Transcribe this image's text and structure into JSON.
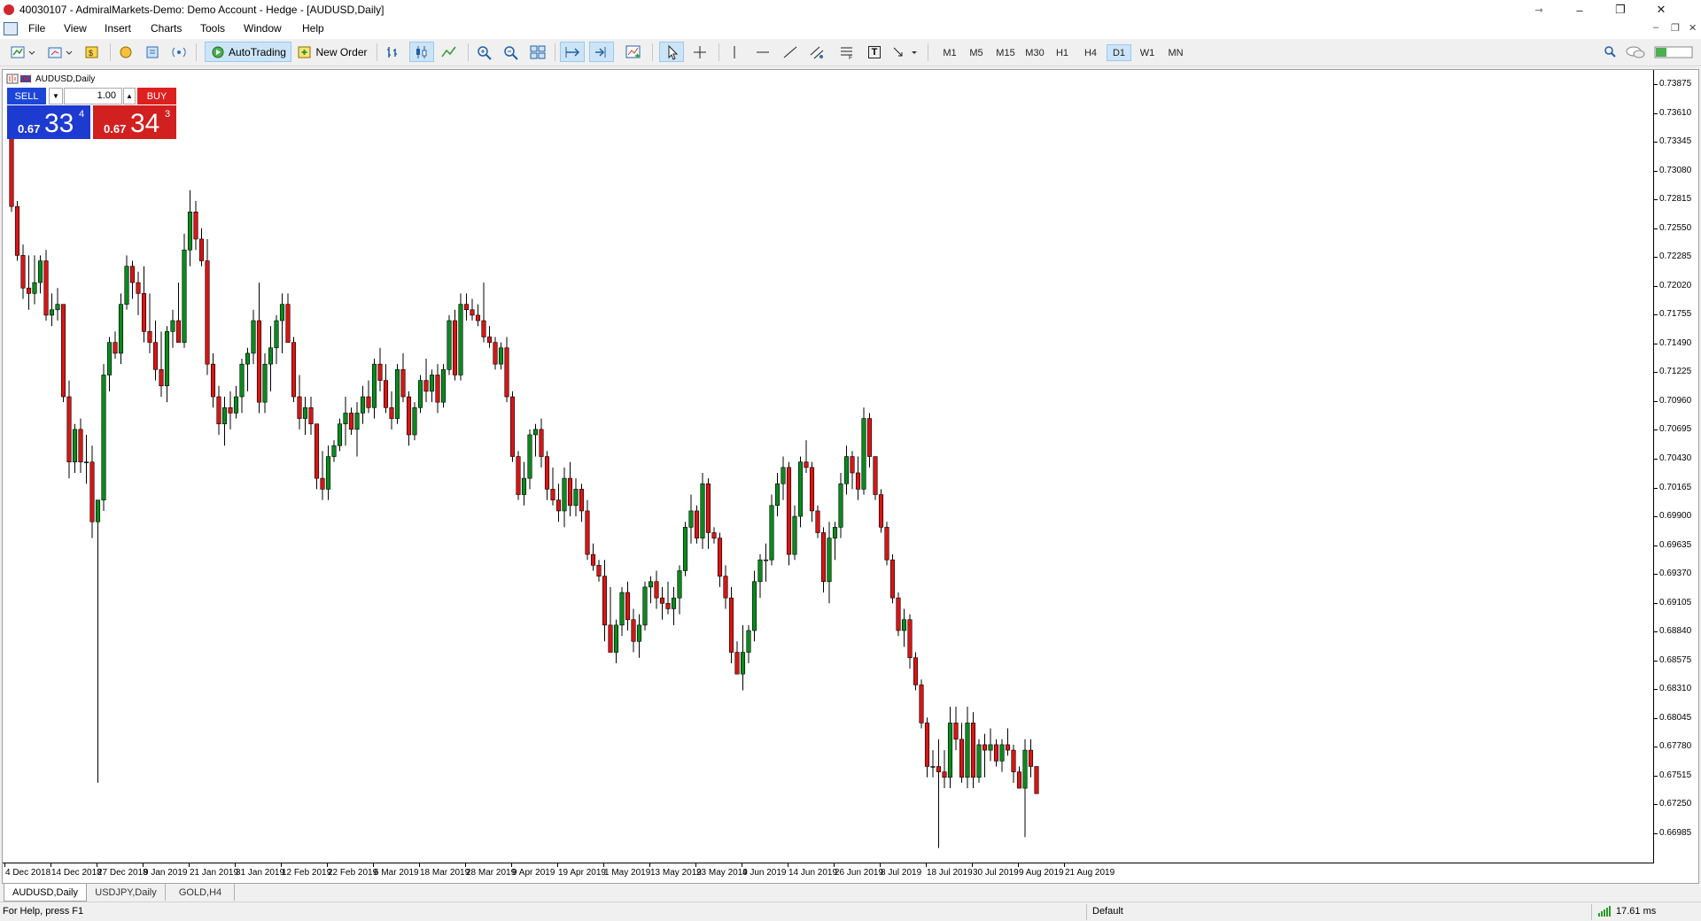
{
  "window": {
    "title": "40030107 - AdmiralMarkets-Demo: Demo Account - Hedge - [AUDUSD,Daily]",
    "controls": {
      "minimize": "–",
      "maximize": "❐",
      "close": "✕",
      "ribbon": "⇾"
    }
  },
  "menu": {
    "items": [
      "File",
      "View",
      "Insert",
      "Charts",
      "Tools",
      "Window",
      "Help"
    ],
    "mdi": {
      "minimize": "–",
      "restore": "❐",
      "close": "✕"
    }
  },
  "toolbar": {
    "autotrading_label": "AutoTrading",
    "new_order_label": "New Order",
    "timeframes": [
      "M1",
      "M5",
      "M15",
      "M30",
      "H1",
      "H4",
      "D1",
      "W1",
      "MN"
    ],
    "active_timeframe": "D1",
    "text_tool": "T",
    "label_tool": "A"
  },
  "chart": {
    "title": "AUDUSD,Daily",
    "one_click": {
      "sell_label": "SELL",
      "buy_label": "BUY",
      "lot": "1.00",
      "sell_small": "0.67",
      "sell_big": "33",
      "sell_sup": "4",
      "buy_small": "0.67",
      "buy_big": "34",
      "buy_sup": "3"
    },
    "price_labels": [
      "0.73875",
      "0.73610",
      "0.73345",
      "0.73080",
      "0.72815",
      "0.72550",
      "0.72285",
      "0.72020",
      "0.71755",
      "0.71490",
      "0.71225",
      "0.70960",
      "0.70695",
      "0.70430",
      "0.70165",
      "0.69900",
      "0.69635",
      "0.69370",
      "0.69105",
      "0.68840",
      "0.68575",
      "0.68310",
      "0.68045",
      "0.67780",
      "0.67515",
      "0.67250",
      "0.66985"
    ],
    "date_labels": [
      "4 Dec 2018",
      "14 Dec 2018",
      "27 Dec 2018",
      "9 Jan 2019",
      "21 Jan 2019",
      "31 Jan 2019",
      "12 Feb 2019",
      "22 Feb 2019",
      "6 Mar 2019",
      "18 Mar 2019",
      "28 Mar 2019",
      "9 Apr 2019",
      "19 Apr 2019",
      "1 May 2019",
      "13 May 2019",
      "23 May 2019",
      "4 Jun 2019",
      "14 Jun 2019",
      "26 Jun 2019",
      "8 Jul 2019",
      "18 Jul 2019",
      "30 Jul 2019",
      "9 Aug 2019",
      "21 Aug 2019"
    ],
    "colors": {
      "bull": "#0a8a1e",
      "bear": "#d81515",
      "wick": "#000000"
    }
  },
  "tabs": [
    "AUDUSD,Daily",
    "USDJPY,Daily",
    "GOLD,H4"
  ],
  "active_tab": "AUDUSD,Daily",
  "status": {
    "help": "For Help, press F1",
    "profile": "Default",
    "ping": "17.61 ms"
  },
  "chart_data": {
    "type": "candlestick",
    "symbol": "AUDUSD",
    "timeframe": "Daily",
    "ylim": [
      0.6685,
      0.74
    ],
    "grid": false,
    "candles": [
      [
        0.7365,
        0.7365,
        0.727,
        0.7275
      ],
      [
        0.7275,
        0.728,
        0.7225,
        0.723
      ],
      [
        0.723,
        0.724,
        0.719,
        0.72
      ],
      [
        0.72,
        0.723,
        0.718,
        0.7195
      ],
      [
        0.7195,
        0.723,
        0.7185,
        0.7205
      ],
      [
        0.7205,
        0.723,
        0.7195,
        0.7225
      ],
      [
        0.7225,
        0.7235,
        0.717,
        0.7175
      ],
      [
        0.7175,
        0.7195,
        0.7165,
        0.718
      ],
      [
        0.718,
        0.72,
        0.717,
        0.7185
      ],
      [
        0.7185,
        0.7185,
        0.7095,
        0.71
      ],
      [
        0.71,
        0.7115,
        0.7025,
        0.704
      ],
      [
        0.704,
        0.7075,
        0.703,
        0.707
      ],
      [
        0.707,
        0.708,
        0.703,
        0.704
      ],
      [
        0.704,
        0.7065,
        0.702,
        0.704
      ],
      [
        0.704,
        0.7055,
        0.697,
        0.6985
      ],
      [
        0.6985,
        0.7,
        0.6745,
        0.7005
      ],
      [
        0.7005,
        0.713,
        0.6995,
        0.712
      ],
      [
        0.712,
        0.7155,
        0.7105,
        0.715
      ],
      [
        0.715,
        0.716,
        0.7135,
        0.714
      ],
      [
        0.714,
        0.7195,
        0.713,
        0.7185
      ],
      [
        0.7185,
        0.723,
        0.718,
        0.722
      ],
      [
        0.722,
        0.7225,
        0.719,
        0.7205
      ],
      [
        0.7205,
        0.7215,
        0.7175,
        0.7195
      ],
      [
        0.7195,
        0.722,
        0.715,
        0.716
      ],
      [
        0.716,
        0.7195,
        0.714,
        0.715
      ],
      [
        0.715,
        0.717,
        0.7115,
        0.7125
      ],
      [
        0.7125,
        0.716,
        0.71,
        0.711
      ],
      [
        0.711,
        0.7165,
        0.7095,
        0.716
      ],
      [
        0.716,
        0.718,
        0.7145,
        0.717
      ],
      [
        0.717,
        0.7205,
        0.715,
        0.715
      ],
      [
        0.715,
        0.725,
        0.7145,
        0.7235
      ],
      [
        0.7235,
        0.729,
        0.722,
        0.727
      ],
      [
        0.727,
        0.728,
        0.7235,
        0.7245
      ],
      [
        0.7245,
        0.7255,
        0.722,
        0.7225
      ],
      [
        0.7225,
        0.7245,
        0.712,
        0.713
      ],
      [
        0.713,
        0.714,
        0.709,
        0.71
      ],
      [
        0.71,
        0.711,
        0.7065,
        0.7075
      ],
      [
        0.7075,
        0.71,
        0.7055,
        0.709
      ],
      [
        0.709,
        0.7105,
        0.707,
        0.7085
      ],
      [
        0.7085,
        0.711,
        0.708,
        0.71
      ],
      [
        0.71,
        0.7135,
        0.7085,
        0.713
      ],
      [
        0.713,
        0.7145,
        0.7105,
        0.714
      ],
      [
        0.714,
        0.718,
        0.713,
        0.717
      ],
      [
        0.717,
        0.7205,
        0.7085,
        0.7095
      ],
      [
        0.7095,
        0.714,
        0.7085,
        0.713
      ],
      [
        0.713,
        0.7165,
        0.7105,
        0.7145
      ],
      [
        0.7145,
        0.7175,
        0.713,
        0.717
      ],
      [
        0.717,
        0.7195,
        0.714,
        0.7185
      ],
      [
        0.7185,
        0.7195,
        0.715,
        0.715
      ],
      [
        0.715,
        0.7155,
        0.7095,
        0.71
      ],
      [
        0.71,
        0.712,
        0.707,
        0.708
      ],
      [
        0.708,
        0.71,
        0.7065,
        0.709
      ],
      [
        0.709,
        0.71,
        0.7065,
        0.7075
      ],
      [
        0.7075,
        0.7075,
        0.7015,
        0.7025
      ],
      [
        0.7025,
        0.705,
        0.7005,
        0.7015
      ],
      [
        0.7015,
        0.7055,
        0.7005,
        0.7045
      ],
      [
        0.7045,
        0.706,
        0.704,
        0.7055
      ],
      [
        0.7055,
        0.708,
        0.705,
        0.7075
      ],
      [
        0.7075,
        0.71,
        0.7055,
        0.7085
      ],
      [
        0.7085,
        0.709,
        0.7065,
        0.707
      ],
      [
        0.707,
        0.7095,
        0.7045,
        0.7085
      ],
      [
        0.7085,
        0.711,
        0.7075,
        0.71
      ],
      [
        0.71,
        0.7115,
        0.7085,
        0.709
      ],
      [
        0.709,
        0.7135,
        0.708,
        0.713
      ],
      [
        0.713,
        0.7145,
        0.7105,
        0.7115
      ],
      [
        0.7115,
        0.713,
        0.7085,
        0.709
      ],
      [
        0.709,
        0.7105,
        0.707,
        0.708
      ],
      [
        0.708,
        0.713,
        0.7075,
        0.7125
      ],
      [
        0.7125,
        0.714,
        0.7095,
        0.71
      ],
      [
        0.71,
        0.7105,
        0.7055,
        0.7065
      ],
      [
        0.7065,
        0.7095,
        0.706,
        0.709
      ],
      [
        0.709,
        0.712,
        0.7085,
        0.7115
      ],
      [
        0.7115,
        0.7135,
        0.7095,
        0.7105
      ],
      [
        0.7105,
        0.7125,
        0.7095,
        0.712
      ],
      [
        0.712,
        0.713,
        0.7085,
        0.7095
      ],
      [
        0.7095,
        0.713,
        0.709,
        0.7125
      ],
      [
        0.7125,
        0.7175,
        0.712,
        0.717
      ],
      [
        0.717,
        0.718,
        0.7115,
        0.712
      ],
      [
        0.712,
        0.7195,
        0.7115,
        0.7185
      ],
      [
        0.7185,
        0.7195,
        0.717,
        0.718
      ],
      [
        0.718,
        0.719,
        0.717,
        0.7175
      ],
      [
        0.7175,
        0.7185,
        0.7165,
        0.717
      ],
      [
        0.717,
        0.7205,
        0.715,
        0.7155
      ],
      [
        0.7155,
        0.7165,
        0.7145,
        0.715
      ],
      [
        0.715,
        0.7155,
        0.7125,
        0.713
      ],
      [
        0.713,
        0.715,
        0.7125,
        0.7145
      ],
      [
        0.7145,
        0.7155,
        0.7095,
        0.71
      ],
      [
        0.71,
        0.7105,
        0.704,
        0.7045
      ],
      [
        0.7045,
        0.705,
        0.7005,
        0.701
      ],
      [
        0.701,
        0.704,
        0.7,
        0.7025
      ],
      [
        0.7025,
        0.707,
        0.7015,
        0.7065
      ],
      [
        0.7065,
        0.7075,
        0.7045,
        0.707
      ],
      [
        0.707,
        0.708,
        0.7035,
        0.7045
      ],
      [
        0.7045,
        0.705,
        0.7005,
        0.7015
      ],
      [
        0.7015,
        0.7035,
        0.7,
        0.7005
      ],
      [
        0.7005,
        0.702,
        0.6985,
        0.6995
      ],
      [
        0.6995,
        0.7035,
        0.698,
        0.7025
      ],
      [
        0.7025,
        0.704,
        0.699,
        0.7
      ],
      [
        0.7,
        0.7025,
        0.699,
        0.7015
      ],
      [
        0.7015,
        0.702,
        0.6985,
        0.6995
      ],
      [
        0.6995,
        0.7005,
        0.695,
        0.6955
      ],
      [
        0.6955,
        0.6965,
        0.694,
        0.6945
      ],
      [
        0.6945,
        0.695,
        0.693,
        0.6935
      ],
      [
        0.6935,
        0.695,
        0.6875,
        0.689
      ],
      [
        0.689,
        0.6925,
        0.6865,
        0.6865
      ],
      [
        0.6865,
        0.6895,
        0.6855,
        0.689
      ],
      [
        0.689,
        0.6925,
        0.688,
        0.692
      ],
      [
        0.692,
        0.693,
        0.6885,
        0.6895
      ],
      [
        0.6895,
        0.6905,
        0.6865,
        0.6875
      ],
      [
        0.6875,
        0.69,
        0.686,
        0.689
      ],
      [
        0.689,
        0.693,
        0.6885,
        0.6925
      ],
      [
        0.6925,
        0.6935,
        0.691,
        0.693
      ],
      [
        0.693,
        0.694,
        0.6905,
        0.6915
      ],
      [
        0.6915,
        0.6925,
        0.6895,
        0.691
      ],
      [
        0.691,
        0.693,
        0.69,
        0.6905
      ],
      [
        0.6905,
        0.6925,
        0.689,
        0.6915
      ],
      [
        0.6915,
        0.6945,
        0.69,
        0.694
      ],
      [
        0.694,
        0.6985,
        0.6935,
        0.698
      ],
      [
        0.698,
        0.701,
        0.6965,
        0.6995
      ],
      [
        0.6995,
        0.7,
        0.6965,
        0.697
      ],
      [
        0.697,
        0.703,
        0.696,
        0.702
      ],
      [
        0.702,
        0.7025,
        0.696,
        0.6975
      ],
      [
        0.6975,
        0.698,
        0.6965,
        0.697
      ],
      [
        0.697,
        0.6975,
        0.6925,
        0.6935
      ],
      [
        0.6935,
        0.6945,
        0.6905,
        0.6915
      ],
      [
        0.6915,
        0.6925,
        0.6855,
        0.6865
      ],
      [
        0.6865,
        0.6875,
        0.6845,
        0.6845
      ],
      [
        0.6845,
        0.689,
        0.683,
        0.6865
      ],
      [
        0.6865,
        0.689,
        0.6855,
        0.6885
      ],
      [
        0.6885,
        0.694,
        0.6875,
        0.693
      ],
      [
        0.693,
        0.6955,
        0.6915,
        0.695
      ],
      [
        0.695,
        0.6965,
        0.693,
        0.695
      ],
      [
        0.695,
        0.701,
        0.6945,
        0.7
      ],
      [
        0.7,
        0.703,
        0.699,
        0.702
      ],
      [
        0.702,
        0.7045,
        0.7005,
        0.7035
      ],
      [
        0.7035,
        0.704,
        0.6945,
        0.6955
      ],
      [
        0.6955,
        0.7,
        0.695,
        0.699
      ],
      [
        0.699,
        0.7045,
        0.698,
        0.704
      ],
      [
        0.704,
        0.706,
        0.703,
        0.7035
      ],
      [
        0.7035,
        0.704,
        0.6985,
        0.6995
      ],
      [
        0.6995,
        0.7,
        0.697,
        0.6975
      ],
      [
        0.6975,
        0.698,
        0.692,
        0.693
      ],
      [
        0.693,
        0.6985,
        0.691,
        0.697
      ],
      [
        0.697,
        0.6985,
        0.695,
        0.698
      ],
      [
        0.698,
        0.703,
        0.697,
        0.702
      ],
      [
        0.702,
        0.7055,
        0.701,
        0.7045
      ],
      [
        0.7045,
        0.705,
        0.7015,
        0.703
      ],
      [
        0.703,
        0.7045,
        0.7005,
        0.7015
      ],
      [
        0.7015,
        0.709,
        0.701,
        0.708
      ],
      [
        0.708,
        0.7085,
        0.7035,
        0.7045
      ],
      [
        0.7045,
        0.7045,
        0.7005,
        0.701
      ],
      [
        0.701,
        0.7015,
        0.6975,
        0.698
      ],
      [
        0.698,
        0.6985,
        0.6945,
        0.695
      ],
      [
        0.695,
        0.6955,
        0.691,
        0.6915
      ],
      [
        0.6915,
        0.692,
        0.688,
        0.6885
      ],
      [
        0.6885,
        0.6905,
        0.687,
        0.6895
      ],
      [
        0.6895,
        0.69,
        0.685,
        0.686
      ],
      [
        0.686,
        0.6865,
        0.683,
        0.6835
      ],
      [
        0.6835,
        0.684,
        0.6795,
        0.68
      ],
      [
        0.68,
        0.6805,
        0.675,
        0.676
      ],
      [
        0.676,
        0.6775,
        0.675,
        0.676
      ],
      [
        0.676,
        0.6785,
        0.6685,
        0.6755
      ],
      [
        0.6755,
        0.6775,
        0.674,
        0.675
      ],
      [
        0.675,
        0.6815,
        0.674,
        0.68
      ],
      [
        0.68,
        0.6815,
        0.6775,
        0.6785
      ],
      [
        0.6785,
        0.68,
        0.6745,
        0.675
      ],
      [
        0.675,
        0.6815,
        0.674,
        0.68
      ],
      [
        0.68,
        0.681,
        0.674,
        0.675
      ],
      [
        0.675,
        0.6785,
        0.6745,
        0.678
      ],
      [
        0.678,
        0.679,
        0.675,
        0.6775
      ],
      [
        0.6775,
        0.6795,
        0.6765,
        0.678
      ],
      [
        0.678,
        0.6785,
        0.676,
        0.6765
      ],
      [
        0.6765,
        0.6785,
        0.6755,
        0.678
      ],
      [
        0.678,
        0.6795,
        0.677,
        0.6775
      ],
      [
        0.6775,
        0.678,
        0.6745,
        0.6755
      ],
      [
        0.6755,
        0.676,
        0.674,
        0.674
      ],
      [
        0.674,
        0.6785,
        0.6695,
        0.6775
      ],
      [
        0.6775,
        0.6785,
        0.675,
        0.676
      ],
      [
        0.676,
        0.676,
        0.6735,
        0.6735
      ]
    ]
  }
}
